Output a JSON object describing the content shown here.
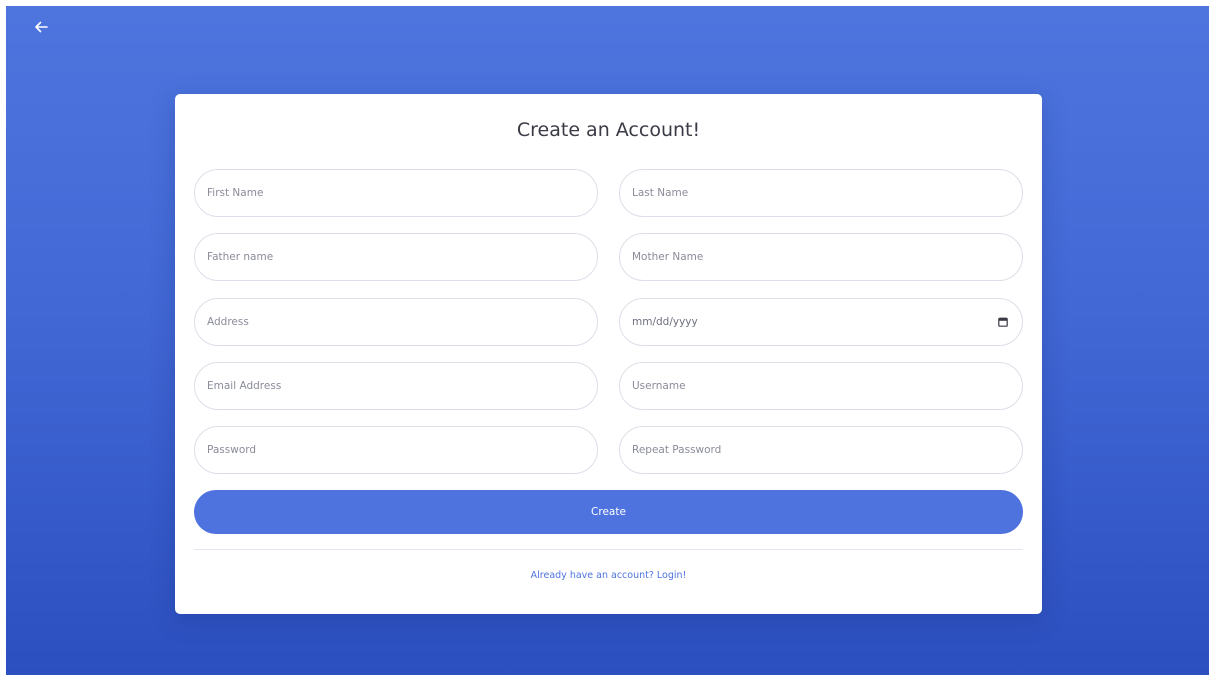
{
  "page": {
    "title": "Create an Account!",
    "back_icon": "arrow-left-icon"
  },
  "form": {
    "first_name": {
      "placeholder": "First Name",
      "value": ""
    },
    "last_name": {
      "placeholder": "Last Name",
      "value": ""
    },
    "father_name": {
      "placeholder": "Father name",
      "value": ""
    },
    "mother_name": {
      "placeholder": "Mother Name",
      "value": ""
    },
    "address": {
      "placeholder": "Address",
      "value": ""
    },
    "date_of_birth": {
      "display": "mm/dd/yyyy",
      "icon": "calendar-icon"
    },
    "email": {
      "placeholder": "Email Address",
      "value": ""
    },
    "username": {
      "placeholder": "Username",
      "value": ""
    },
    "password": {
      "placeholder": "Password",
      "value": ""
    },
    "repeat_password": {
      "placeholder": "Repeat Password",
      "value": ""
    }
  },
  "actions": {
    "create_label": "Create",
    "login_link": "Already have an account? Login!"
  },
  "colors": {
    "background_top": "#4e75de",
    "background_bottom": "#2c4fbf",
    "primary": "#4e73df",
    "card": "#ffffff",
    "field_border": "#dcdfe8"
  }
}
